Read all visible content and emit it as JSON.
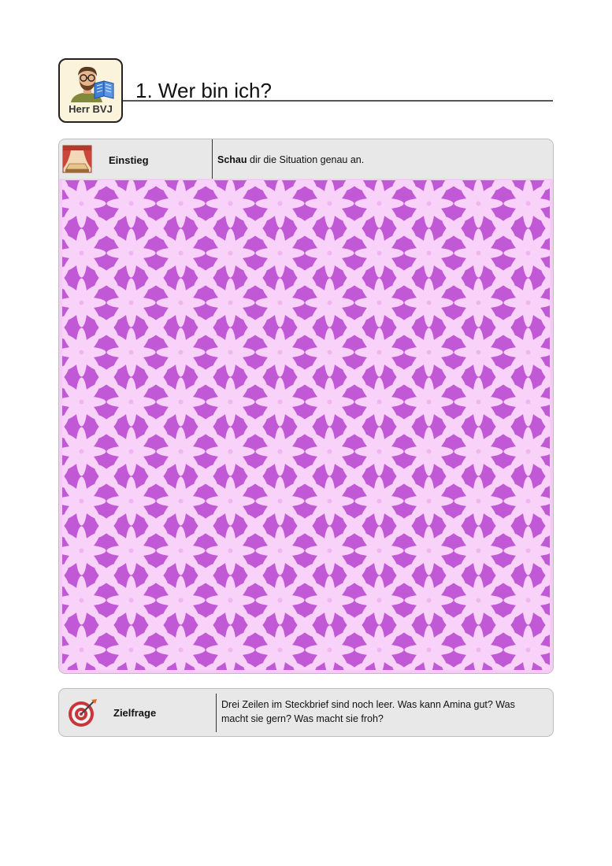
{
  "header": {
    "logo_name": "Herr BVJ",
    "title": "1. Wer bin ich?"
  },
  "einstieg": {
    "label": "Einstieg",
    "icon": "theater-stage-icon",
    "instruction_bold": "Schau",
    "instruction_rest": " dir die Situation genau an.",
    "image": {
      "description_icon": "floral-pattern-image",
      "colors": {
        "background": "#f7c9f7",
        "petal": "#f8d2f8",
        "fill": "#c158d6"
      }
    }
  },
  "zielfrage": {
    "label": "Zielfrage",
    "icon": "target-icon",
    "text": "Drei Zeilen im Steckbrief sind noch leer. Was kann Amina gut? Was macht sie gern? Was macht sie froh?"
  }
}
